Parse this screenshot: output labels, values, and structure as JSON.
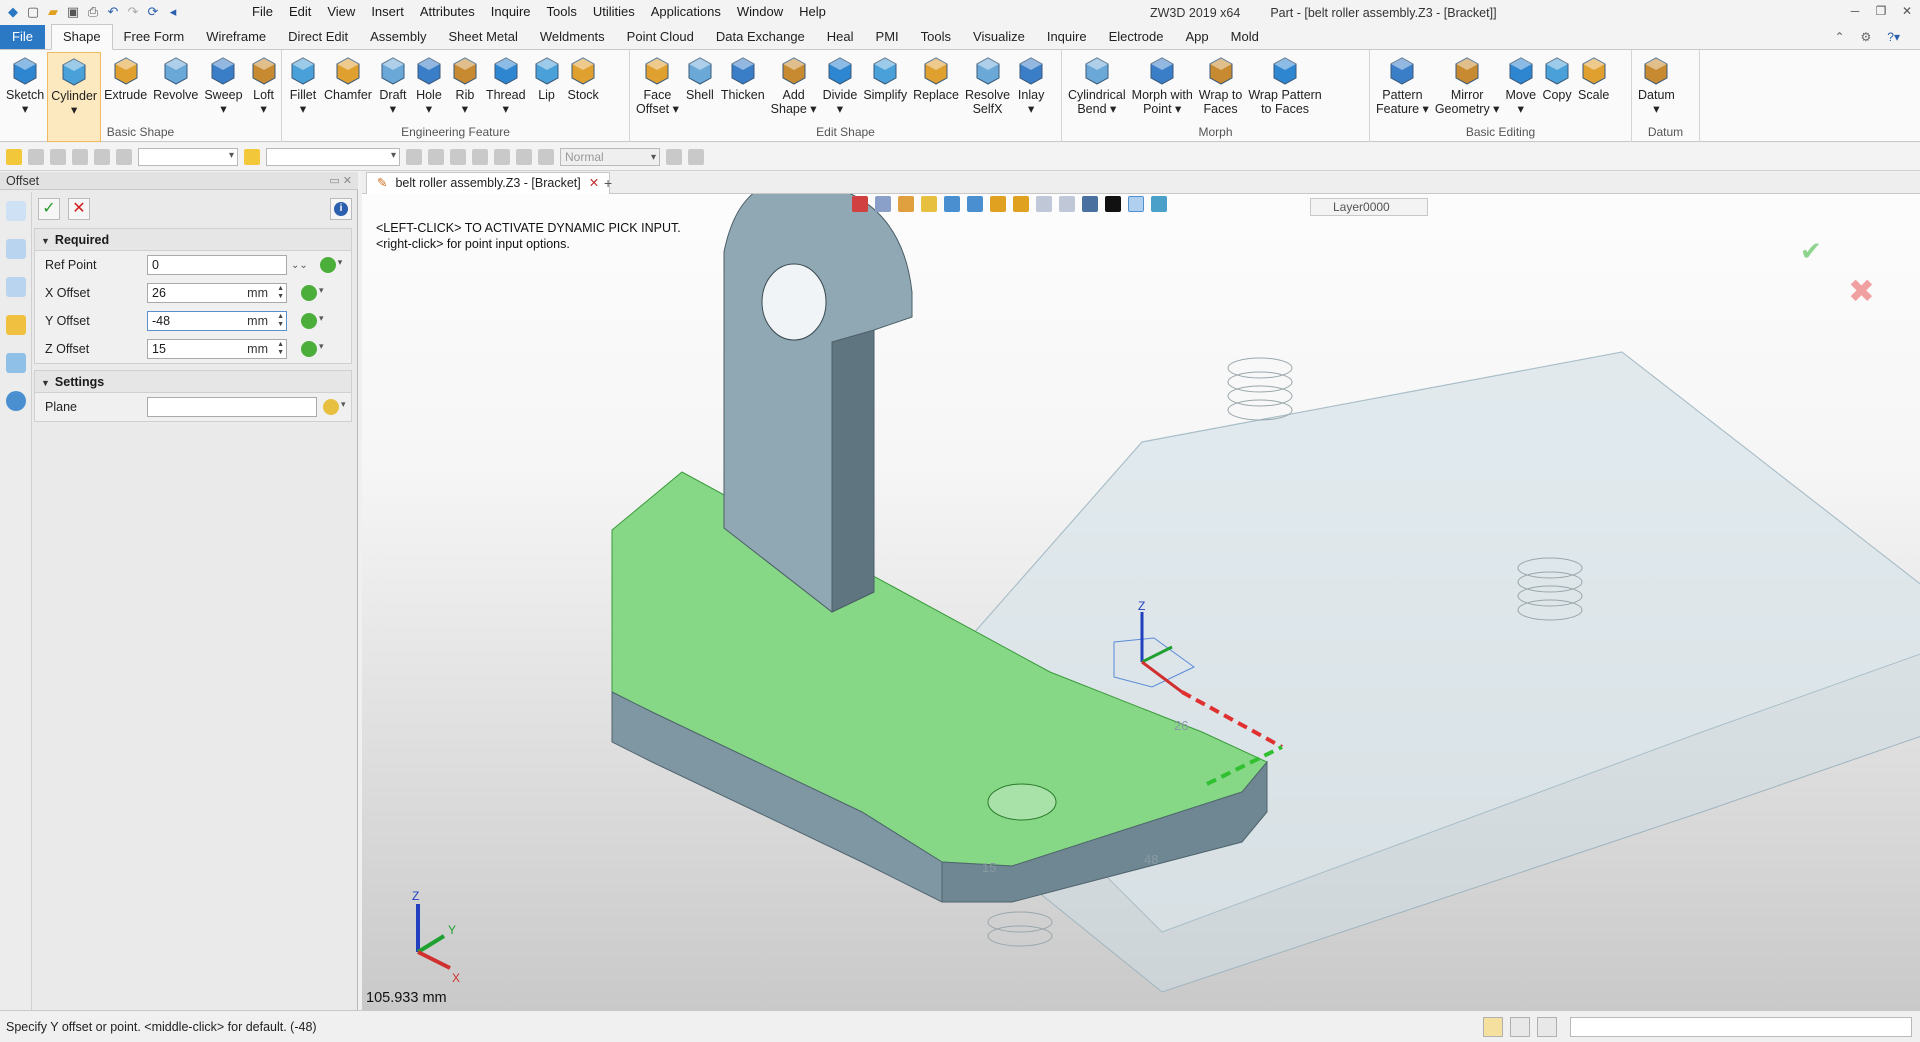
{
  "window": {
    "app": "ZW3D 2019  x64",
    "doc": "Part - [belt roller assembly.Z3 - [Bracket]]"
  },
  "menu": [
    "File",
    "Edit",
    "View",
    "Insert",
    "Attributes",
    "Inquire",
    "Tools",
    "Utilities",
    "Applications",
    "Window",
    "Help"
  ],
  "ribbon_tabs": [
    "File",
    "Shape",
    "Free Form",
    "Wireframe",
    "Direct Edit",
    "Assembly",
    "Sheet Metal",
    "Weldments",
    "Point Cloud",
    "Data Exchange",
    "Heal",
    "PMI",
    "Tools",
    "Visualize",
    "Inquire",
    "Electrode",
    "App",
    "Mold"
  ],
  "active_tab": "Shape",
  "groups": [
    {
      "label": "Basic Shape",
      "buttons": [
        {
          "l1": "Sketch",
          "l2": "▾"
        },
        {
          "l1": "Cylinder",
          "l2": "▾"
        },
        {
          "l1": "Extrude",
          "l2": ""
        },
        {
          "l1": "Revolve",
          "l2": ""
        },
        {
          "l1": "Sweep",
          "l2": "▾"
        },
        {
          "l1": "Loft",
          "l2": "▾"
        }
      ]
    },
    {
      "label": "Engineering Feature",
      "buttons": [
        {
          "l1": "Fillet",
          "l2": "▾"
        },
        {
          "l1": "Chamfer",
          "l2": ""
        },
        {
          "l1": "Draft",
          "l2": "▾"
        },
        {
          "l1": "Hole",
          "l2": "▾"
        },
        {
          "l1": "Rib",
          "l2": "▾"
        },
        {
          "l1": "Thread",
          "l2": "▾"
        },
        {
          "l1": "Lip",
          "l2": ""
        },
        {
          "l1": "Stock",
          "l2": ""
        }
      ]
    },
    {
      "label": "Edit Shape",
      "buttons": [
        {
          "l1": "Face",
          "l2": "Offset ▾"
        },
        {
          "l1": "Shell",
          "l2": ""
        },
        {
          "l1": "Thicken",
          "l2": ""
        },
        {
          "l1": "Add",
          "l2": "Shape ▾"
        },
        {
          "l1": "Divide",
          "l2": "▾"
        },
        {
          "l1": "Simplify",
          "l2": ""
        },
        {
          "l1": "Replace",
          "l2": ""
        },
        {
          "l1": "Resolve",
          "l2": "SelfX"
        },
        {
          "l1": "Inlay",
          "l2": "▾"
        }
      ]
    },
    {
      "label": "Morph",
      "buttons": [
        {
          "l1": "Cylindrical",
          "l2": "Bend ▾"
        },
        {
          "l1": "Morph with",
          "l2": "Point ▾"
        },
        {
          "l1": "Wrap to",
          "l2": "Faces"
        },
        {
          "l1": "Wrap Pattern",
          "l2": "to Faces"
        }
      ]
    },
    {
      "label": "Basic Editing",
      "buttons": [
        {
          "l1": "Pattern",
          "l2": "Feature ▾"
        },
        {
          "l1": "Mirror",
          "l2": "Geometry ▾"
        },
        {
          "l1": "Move",
          "l2": "▾"
        },
        {
          "l1": "Copy",
          "l2": ""
        },
        {
          "l1": "Scale",
          "l2": ""
        }
      ]
    },
    {
      "label": "Datum",
      "buttons": [
        {
          "l1": "Datum",
          "l2": "▾"
        }
      ]
    }
  ],
  "toolbar2": {
    "mode": "Normal"
  },
  "panel": {
    "title": "Offset",
    "required_label": "Required",
    "fields": [
      {
        "label": "Ref Point",
        "value": "0",
        "unit": ""
      },
      {
        "label": "X Offset",
        "value": "26",
        "unit": "mm"
      },
      {
        "label": "Y Offset",
        "value": "-48",
        "unit": "mm"
      },
      {
        "label": "Z Offset",
        "value": "15",
        "unit": "mm"
      }
    ],
    "settings_label": "Settings",
    "plane_label": "Plane",
    "plane_value": ""
  },
  "doc_tab": "belt roller assembly.Z3 - [Bracket]",
  "layer": "Layer0000",
  "prompt_line1": "<LEFT-CLICK> TO ACTIVATE DYNAMIC PICK INPUT.",
  "prompt_line2": "<right-click> for point input options.",
  "dims": {
    "x": "26",
    "z": "15",
    "y": "48"
  },
  "measure": "105.933 mm",
  "status": "Specify Y offset or point.  <middle-click> for default. (-48)",
  "colors": {
    "accent": "#2b78c5",
    "highlight": "#86d886",
    "part": "#8fa8b4"
  }
}
